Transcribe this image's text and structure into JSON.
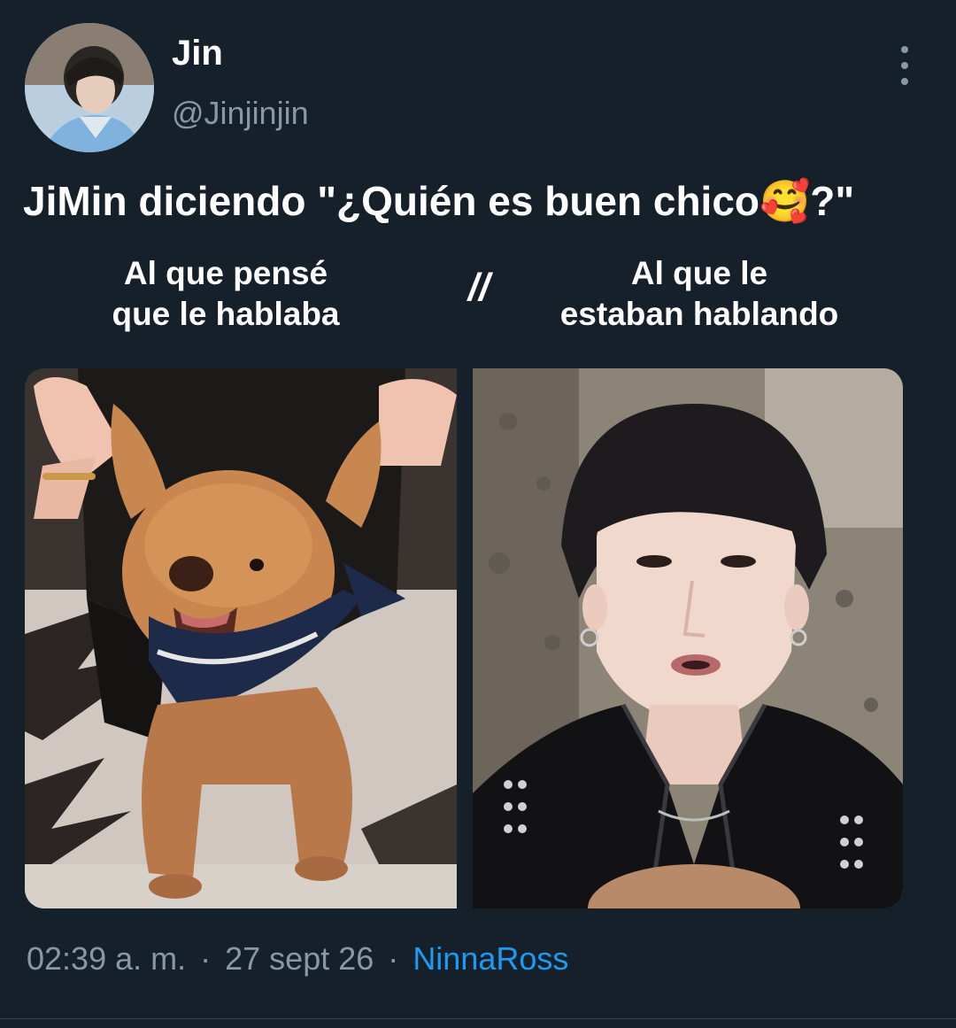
{
  "header": {
    "display_name": "Jin",
    "handle": "@Jinjinjin"
  },
  "tweet": {
    "text": "JiMin diciendo \"¿Quién es buen chico🥰?\""
  },
  "captions": {
    "left_line1": "Al que pensé",
    "left_line2": "que le hablaba",
    "separator": "//",
    "right_line1": "Al que le",
    "right_line2": "estaban hablando"
  },
  "footer": {
    "time": "02:39 a. m.",
    "date": "27 sept 26",
    "source": "NinnaRoss",
    "dot": "·"
  },
  "colors": {
    "background": "#15202b",
    "text": "#ffffff",
    "muted": "#8899a6",
    "link": "#1d9bf0"
  },
  "icons": {
    "more": "more-vertical-icon"
  }
}
